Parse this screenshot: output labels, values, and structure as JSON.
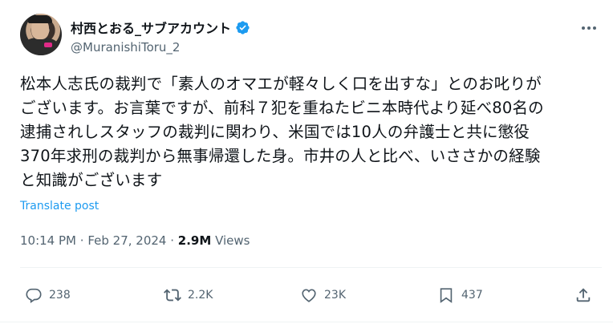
{
  "author": {
    "display_name": "村西とおる_サブアカウント",
    "handle": "@MuranishiToru_2",
    "verified": true
  },
  "tweet": {
    "lines": [
      "松本人志氏の裁判で「素人のオマエが軽々しく口を出すな」とのお叱りが",
      "ございます。お言葉ですが、前科７犯を重ねたビニ本時代より延べ80名の",
      "逮捕されしスタッフの裁判に関わり、米国では10人の弁護士と共に懲役",
      "370年求刑の裁判から無事帰還した身。市井の人と比べ、いささかの経験",
      "と知識がございます"
    ],
    "translate_label": "Translate post"
  },
  "meta": {
    "time": "10:14 PM",
    "separator": "·",
    "date": "Feb 27, 2024",
    "views_count": "2.9M",
    "views_label": "Views"
  },
  "actions": {
    "replies": "238",
    "reposts": "2.2K",
    "likes": "23K",
    "bookmarks": "437"
  },
  "colors": {
    "text": "#0f1419",
    "secondary": "#536471",
    "link": "#1d9bf0",
    "verified": "#1d9bf0"
  }
}
